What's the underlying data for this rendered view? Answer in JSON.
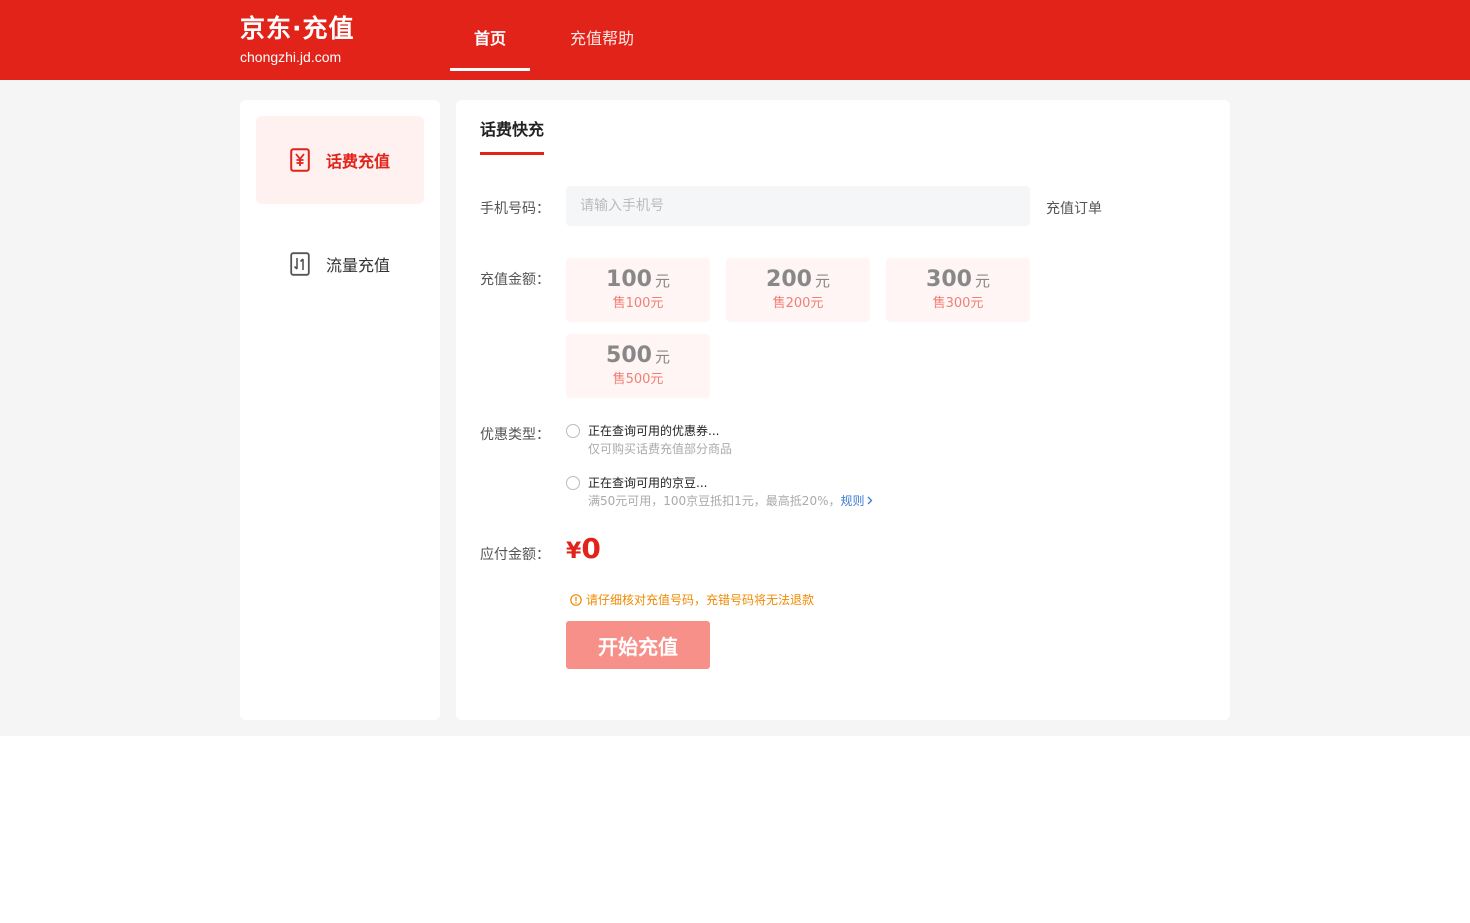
{
  "header": {
    "logo_title": "京东·充值",
    "logo_domain": "chongzhi.jd.com",
    "nav": [
      {
        "label": "首页",
        "active": true
      },
      {
        "label": "充值帮助",
        "active": false
      }
    ]
  },
  "sidebar": {
    "items": [
      {
        "label": "话费充值",
        "icon": "yen-card-icon",
        "active": true
      },
      {
        "label": "流量充值",
        "icon": "data-flow-icon",
        "active": false
      }
    ]
  },
  "main": {
    "tab_title": "话费快充",
    "phone": {
      "label": "手机号码：",
      "placeholder": "请输入手机号",
      "value": "",
      "order_link": "充值订单"
    },
    "amount": {
      "label": "充值金额：",
      "unit": "元",
      "options": [
        {
          "value": "100",
          "sale": "售100元"
        },
        {
          "value": "200",
          "sale": "售200元"
        },
        {
          "value": "300",
          "sale": "售300元"
        },
        {
          "value": "500",
          "sale": "售500元"
        }
      ]
    },
    "discount": {
      "label": "优惠类型：",
      "options": [
        {
          "title": "正在查询可用的优惠券...",
          "desc": "仅可购买话费充值部分商品"
        },
        {
          "title": "正在查询可用的京豆...",
          "desc": "满50元可用，100京豆抵扣1元，最高抵20%，",
          "link": "规则"
        }
      ]
    },
    "payable": {
      "label": "应付金额：",
      "currency": "¥",
      "value": "0"
    },
    "warning": "请仔细核对充值号码，充错号码将无法退款",
    "submit_label": "开始充值"
  },
  "colors": {
    "brand_red": "#e2231a",
    "button_disabled": "#f8908a",
    "warning": "#f08a00",
    "link": "#3b7bd3"
  }
}
